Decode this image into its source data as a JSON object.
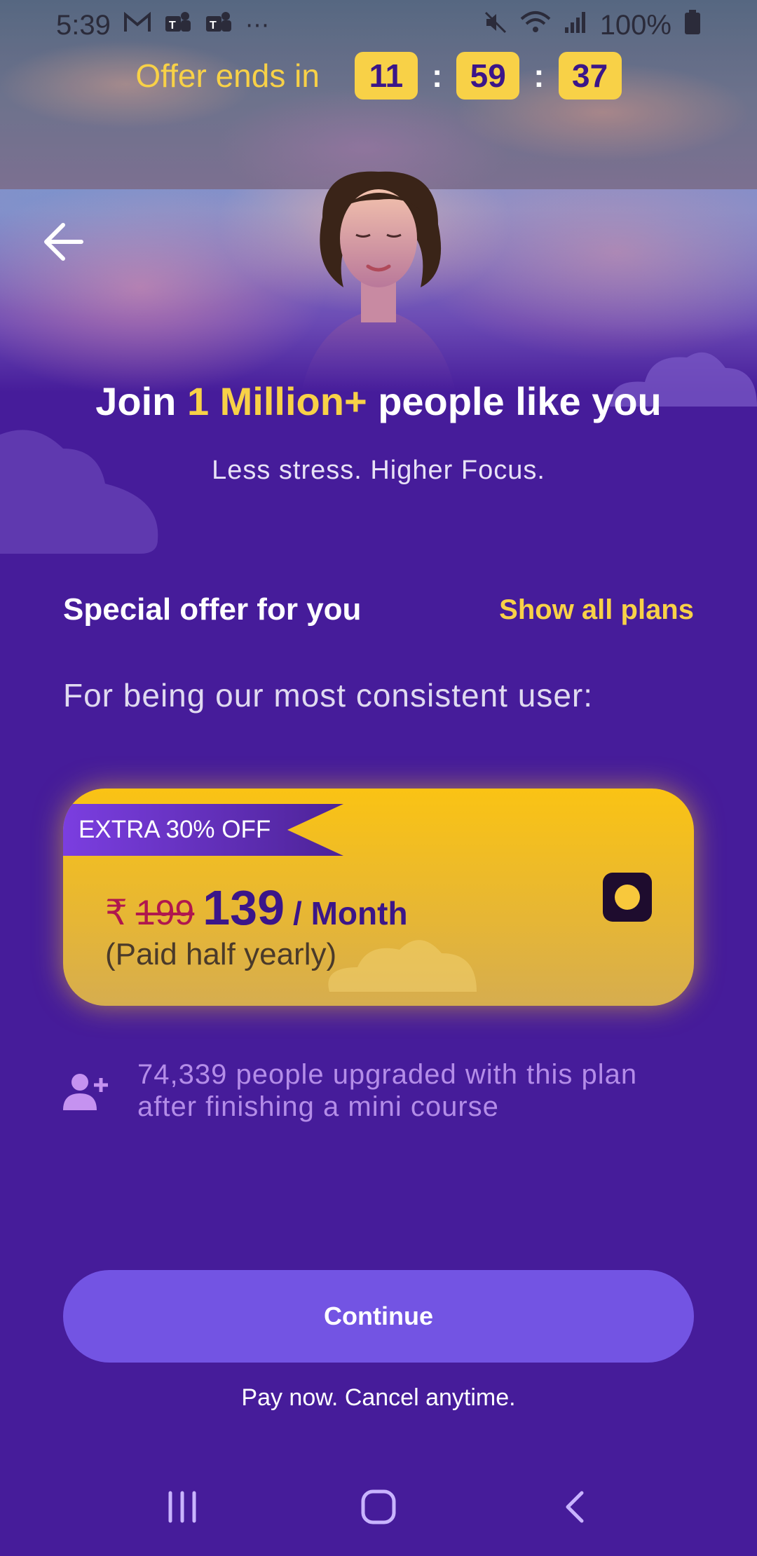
{
  "status_bar": {
    "time": "5:39",
    "left_icons": [
      "gmail-icon",
      "teams-icon",
      "teams-icon",
      "more-icon"
    ],
    "battery": "100%",
    "right_icons": [
      "mute-icon",
      "wifi-icon",
      "signal-icon",
      "battery-icon"
    ]
  },
  "offer": {
    "label": "Offer ends in",
    "hours": "11",
    "minutes": "59",
    "seconds": "37",
    "separator": ":"
  },
  "headline": {
    "prefix": "Join ",
    "highlight": "1 Million+",
    "suffix": " people like you"
  },
  "subline": "Less stress. Higher Focus.",
  "section": {
    "title": "Special offer for you",
    "show_all": "Show all plans"
  },
  "consistent_text": "For being our most consistent user:",
  "plan": {
    "badge": "EXTRA 30% OFF",
    "currency": "₹",
    "old_price": "199",
    "new_price": "139",
    "period": "/ Month",
    "billing": "(Paid half yearly)",
    "selected": true
  },
  "proof": {
    "text": "74,339 people upgraded with this plan after finishing a mini course"
  },
  "cta": {
    "label": "Continue",
    "footnote": "Pay now. Cancel anytime."
  },
  "colors": {
    "background": "#461c9a",
    "accent_yellow": "#f8d147",
    "button": "#7354e3",
    "strike_price": "#b0174e"
  }
}
